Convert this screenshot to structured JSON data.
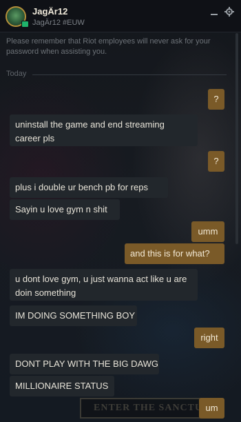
{
  "header": {
    "name": "JagÄr12",
    "tag": "JagÄr12 #EUW"
  },
  "notice": "Please remember that Riot employees will never ask for your password when assisting you.",
  "date_divider": "Today",
  "messages": [
    {
      "dir": "out",
      "text": "?"
    },
    {
      "dir": "in",
      "text": "uninstall the game and end streaming career pls"
    },
    {
      "dir": "out",
      "text": "?"
    },
    {
      "dir": "in",
      "text": "plus i double ur bench pb for reps"
    },
    {
      "dir": "in",
      "text": "Sayin u love gym n shit"
    },
    {
      "dir": "out",
      "text": "umm"
    },
    {
      "dir": "out",
      "text": "and this is for what?"
    },
    {
      "dir": "in",
      "text": "u dont love gym, u just wanna act like u are doin something"
    },
    {
      "dir": "in",
      "text": "IM DOING SOMETHING BOY"
    },
    {
      "dir": "out",
      "text": "right"
    },
    {
      "dir": "in",
      "text": "DONT PLAY WITH THE BIG DAWG"
    },
    {
      "dir": "in",
      "text": "MILLIONAIRE STATUS"
    },
    {
      "dir": "out",
      "text": "um"
    }
  ],
  "background_button": "ENTER THE SANCTUM",
  "icons": {
    "minimize": "minimize-icon",
    "settings": "gear-icon",
    "avatar": "profile-avatar",
    "status": "online-status-icon"
  },
  "colors": {
    "outgoing_bubble": "#7a5a28",
    "incoming_bubble": "#22272c",
    "online": "#1fb36b",
    "avatar_border": "#b48f3a"
  }
}
